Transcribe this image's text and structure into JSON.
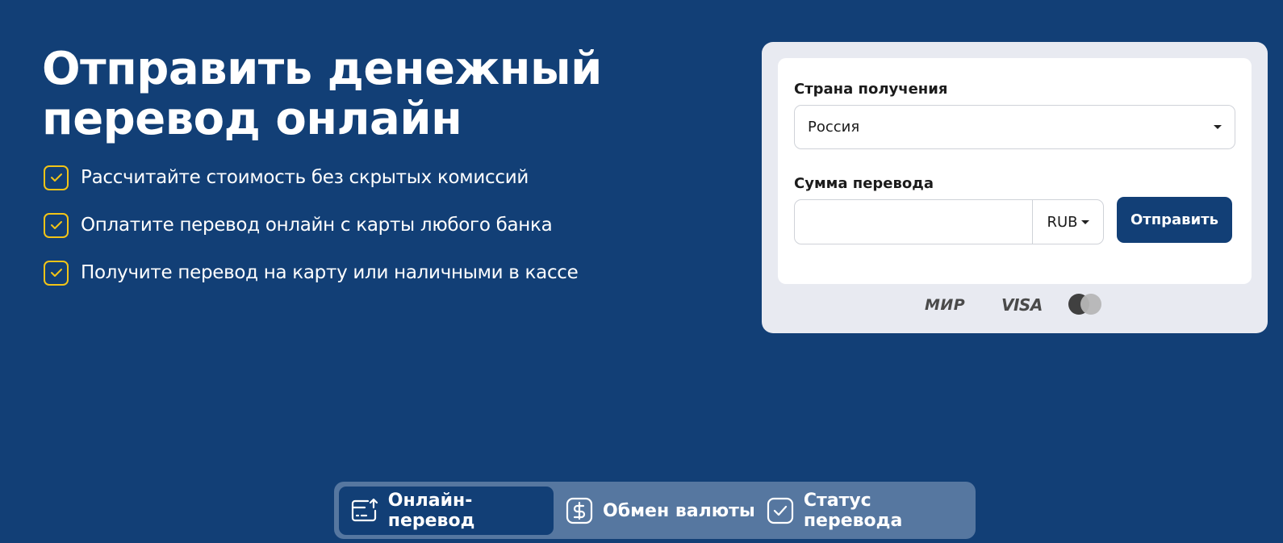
{
  "hero": {
    "title_line1": "Отправить денежный",
    "title_line2": "перевод онлайн",
    "benefits": [
      "Рассчитайте стоимость без скрытых комиссий",
      "Оплатите перевод онлайн с карты любого банка",
      "Получите перевод на карту или наличными в кассе"
    ]
  },
  "form": {
    "country_label": "Страна получения",
    "country_value": "Россия",
    "amount_label": "Сумма перевода",
    "amount_value": "",
    "currency": "RUB",
    "send_label": "Отправить"
  },
  "payment_logos": {
    "mir": "МИР",
    "visa": "VISA",
    "mastercard": "mastercard-logo"
  },
  "tabs": [
    {
      "label": "Онлайн-перевод",
      "icon": "online-transfer-icon",
      "active": true
    },
    {
      "label": "Обмен валюты",
      "icon": "dollar-exchange-icon",
      "active": false
    },
    {
      "label": "Статус перевода",
      "icon": "check-status-icon",
      "active": false
    }
  ],
  "colors": {
    "background": "#123f76",
    "accent_yellow": "#f2c417",
    "card_bg": "#e8eaf1",
    "tabbar_bg": "#5677a0"
  }
}
